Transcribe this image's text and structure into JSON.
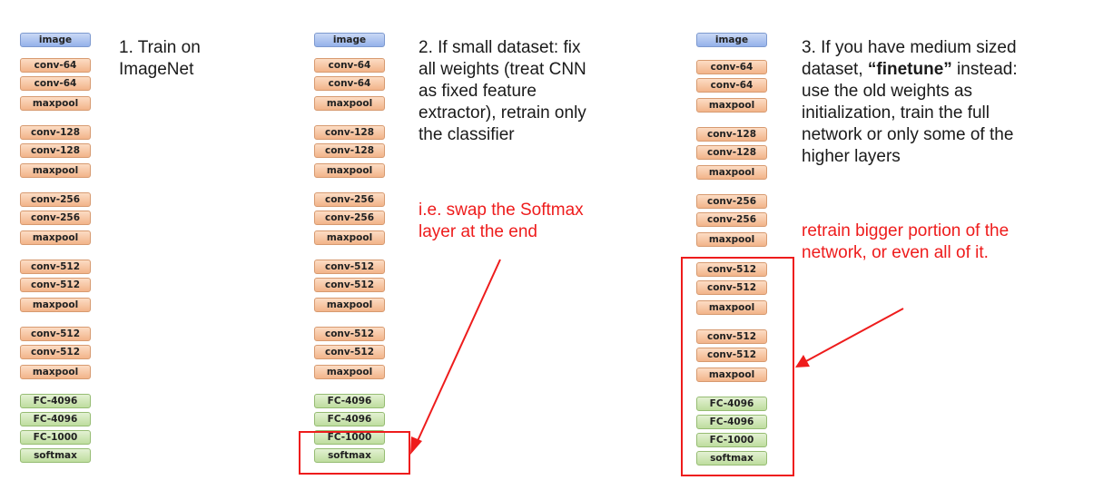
{
  "layers": [
    "image",
    "conv-64",
    "conv-64",
    "maxpool",
    "conv-128",
    "conv-128",
    "maxpool",
    "conv-256",
    "conv-256",
    "maxpool",
    "conv-512",
    "conv-512",
    "maxpool",
    "conv-512",
    "conv-512",
    "maxpool",
    "FC-4096",
    "FC-4096",
    "FC-1000",
    "softmax"
  ],
  "panels": [
    {
      "step": "1. Train on\nImageNet",
      "note": ""
    },
    {
      "step": "2. If small dataset: fix\nall weights (treat CNN\nas fixed feature\nextractor), retrain only\nthe classifier",
      "note": "i.e. swap the Softmax\nlayer at the end"
    },
    {
      "step_pre": "3. If you have medium sized\ndataset, ",
      "step_bold": "“finetune”",
      "step_post": " instead:\nuse the old weights as\ninitialization, train the full\nnetwork or only some of the\nhigher layers",
      "note": "retrain bigger portion of the\nnetwork, or even all of it."
    }
  ],
  "colors": {
    "highlight": "#ee1c1c",
    "image": "#95b2ea",
    "conv": "#f2b48a",
    "fc": "#bedd9e"
  }
}
